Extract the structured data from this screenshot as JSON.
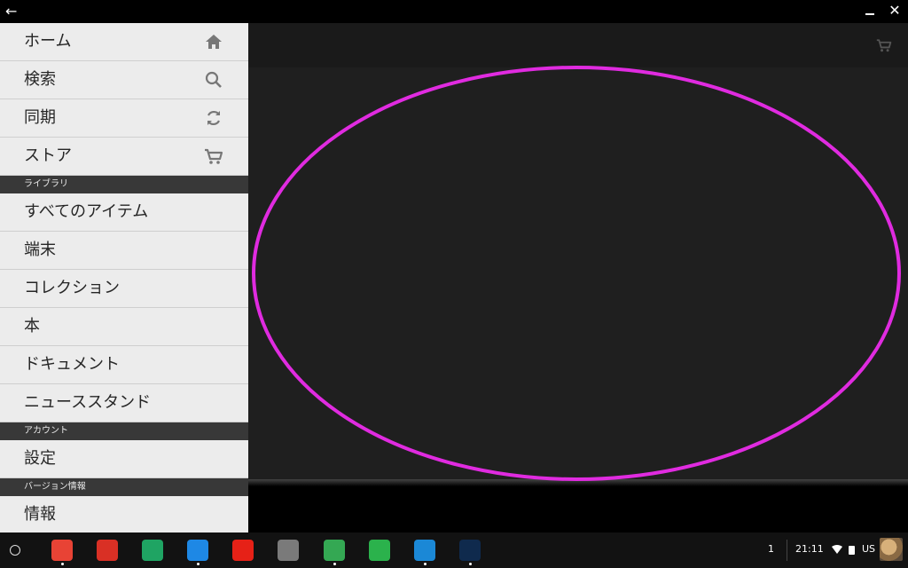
{
  "window": {
    "back_icon": "back-arrow-icon",
    "minimize_icon": "minimize-icon",
    "close_icon": "close-icon"
  },
  "drawer": {
    "top_items": [
      {
        "label": "ホーム",
        "icon": "home-icon"
      },
      {
        "label": "検索",
        "icon": "search-icon"
      },
      {
        "label": "同期",
        "icon": "sync-icon"
      },
      {
        "label": "ストア",
        "icon": "cart-icon"
      }
    ],
    "library_header": "ライブラリ",
    "library_items": [
      {
        "label": "すべてのアイテム"
      },
      {
        "label": "端末"
      },
      {
        "label": "コレクション"
      },
      {
        "label": "本"
      },
      {
        "label": "ドキュメント"
      },
      {
        "label": "ニューススタンド"
      }
    ],
    "account_header": "アカウント",
    "account_items": [
      {
        "label": "設定"
      }
    ],
    "version_header": "バージョン情報",
    "version_items": [
      {
        "label": "情報"
      }
    ]
  },
  "content": {
    "store_icon": "cart-icon",
    "highlight_color": "#e02be0"
  },
  "shelf": {
    "apps": [
      {
        "name": "chrome",
        "color": "#e84335",
        "running": true
      },
      {
        "name": "gmail",
        "color": "#d93025",
        "running": false
      },
      {
        "name": "drive",
        "color": "#1fa463",
        "running": false
      },
      {
        "name": "files",
        "color": "#1e88e5",
        "running": true
      },
      {
        "name": "youtube",
        "color": "#e62117",
        "running": false
      },
      {
        "name": "web-store",
        "color": "#7a7a7a",
        "running": false
      },
      {
        "name": "play-store",
        "color": "#34a853",
        "running": true
      },
      {
        "name": "feedly",
        "color": "#2bb24c",
        "running": false
      },
      {
        "name": "camera",
        "color": "#1b88d6",
        "running": true
      },
      {
        "name": "kindle",
        "color": "#0f2a4d",
        "running": true
      }
    ],
    "notification_count": "1",
    "clock": "21:11",
    "input_language": "US"
  }
}
